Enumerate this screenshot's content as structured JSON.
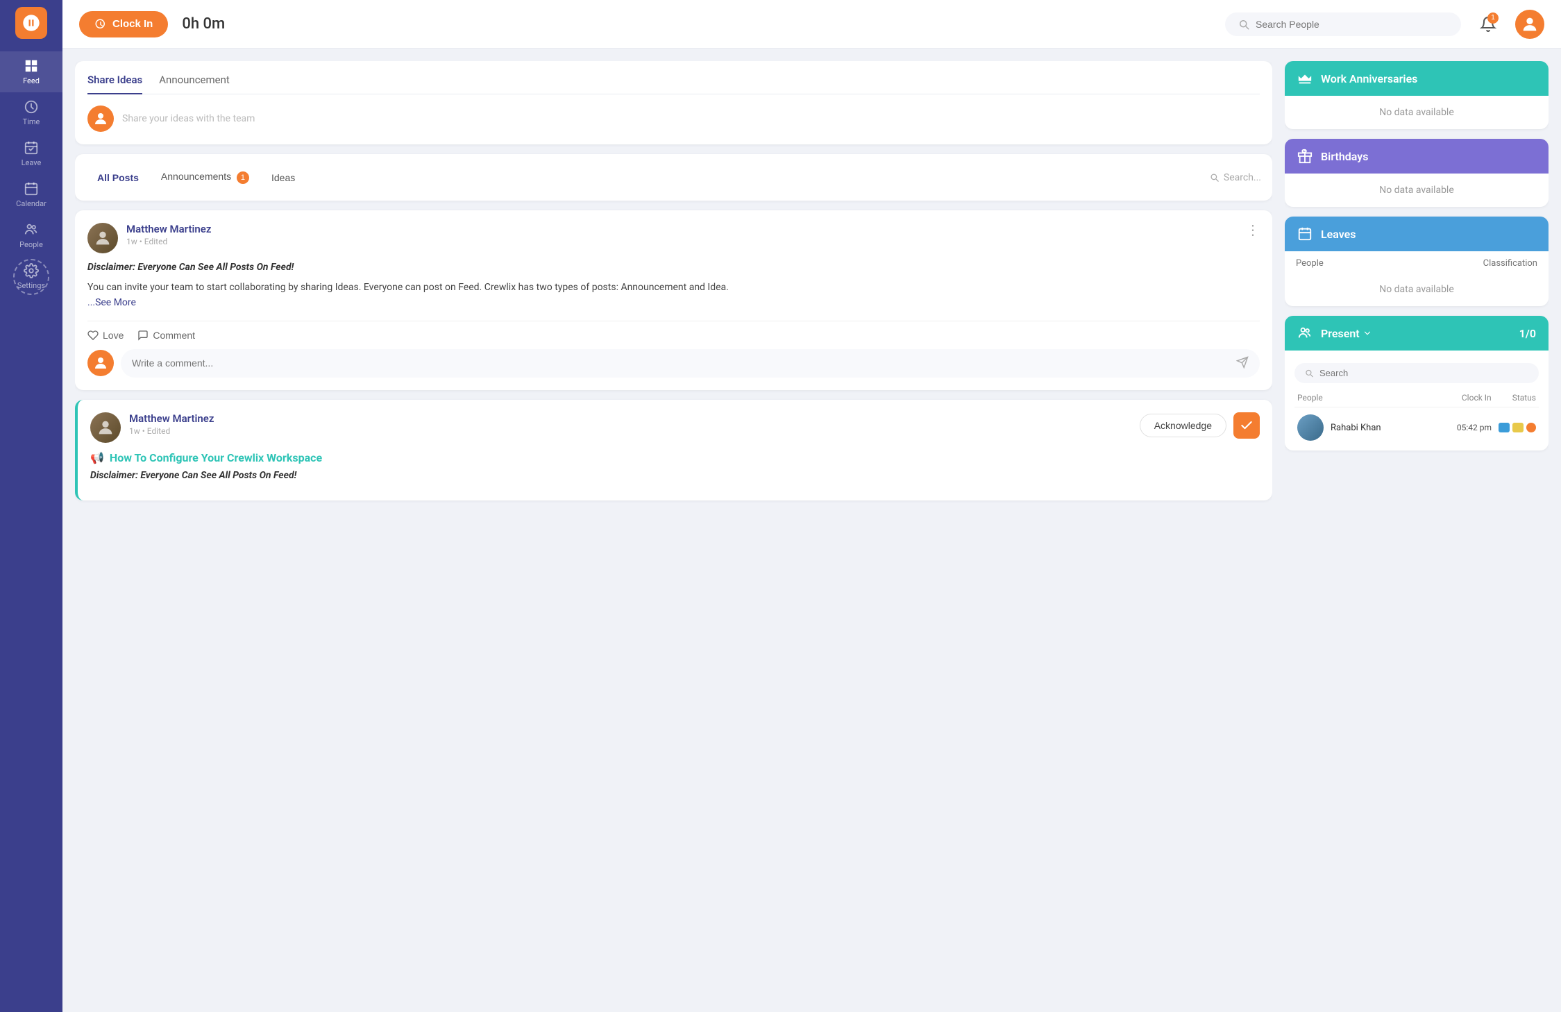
{
  "sidebar": {
    "logo_alt": "Crewlix Logo",
    "items": [
      {
        "id": "feed",
        "label": "Feed",
        "active": true
      },
      {
        "id": "time",
        "label": "Time"
      },
      {
        "id": "leave",
        "label": "Leave"
      },
      {
        "id": "calendar",
        "label": "Calendar"
      },
      {
        "id": "people",
        "label": "People"
      },
      {
        "id": "settings",
        "label": "Settings"
      }
    ]
  },
  "header": {
    "clock_in_label": "Clock In",
    "timer": "0h 0m",
    "search_placeholder": "Search People",
    "notification_count": "1"
  },
  "share_ideas": {
    "tab_ideas": "Share Ideas",
    "tab_announcement": "Announcement",
    "placeholder": "Share your ideas with the team"
  },
  "filter_bar": {
    "all_posts": "All Posts",
    "announcements": "Announcements",
    "announcement_count": "1",
    "ideas": "Ideas",
    "search_placeholder": "Search..."
  },
  "post1": {
    "author": "Matthew Martinez",
    "time": "1w • Edited",
    "title": "Disclaimer: Everyone Can See All Posts On Feed!",
    "body": "You can invite your team to start collaborating by sharing Ideas. Everyone can post on Feed. Crewlix has two types of posts: Announcement and Idea.",
    "see_more": "...See More",
    "love_label": "Love",
    "comment_label": "Comment",
    "comment_placeholder": "Write a comment..."
  },
  "post2": {
    "author": "Matthew Martinez",
    "time": "1w • Edited",
    "title": "How To Configure Your Crewlix Workspace",
    "title_icon": "📢",
    "disclaimer": "Disclaimer: Everyone Can See All Posts On Feed!",
    "acknowledge_label": "Acknowledge"
  },
  "widgets": {
    "anniversaries": {
      "title": "Work Anniversaries",
      "no_data": "No data available"
    },
    "birthdays": {
      "title": "Birthdays",
      "no_data": "No data available"
    },
    "leaves": {
      "title": "Leaves",
      "people_col": "People",
      "classification_col": "Classification",
      "no_data": "No data available"
    },
    "present": {
      "title": "Present",
      "count": "1/0",
      "search_placeholder": "Search",
      "people_col": "People",
      "clock_in_col": "Clock In",
      "status_col": "Status",
      "person": {
        "name": "Rahabi Khan",
        "clock_in": "05:42 pm"
      }
    }
  }
}
